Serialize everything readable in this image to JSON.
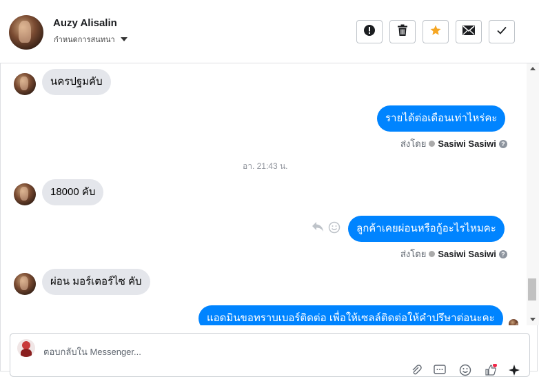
{
  "header": {
    "name": "Auzy Alisalin",
    "subtitle": "กำหนดการสนทนา",
    "buttons": [
      {
        "name": "report-button",
        "icon": "exclamation-icon"
      },
      {
        "name": "delete-button",
        "icon": "trash-icon"
      },
      {
        "name": "star-button",
        "icon": "star-icon"
      },
      {
        "name": "mail-button",
        "icon": "envelope-icon"
      },
      {
        "name": "done-button",
        "icon": "check-icon"
      }
    ]
  },
  "messages": {
    "m1": "นครปฐมคับ",
    "m2": "รายได้ต่อเดือนเท่าไหร่คะ",
    "m3": "18000 คับ",
    "m4": "ลูกค้าเคยผ่อนหรือกู้อะไรไหมคะ",
    "m5": "ผ่อน มอร์เตอร์ไซ คับ",
    "m6": "แอดมินขอทราบเบอร์ติดต่อ เพื่อให้เซลล์ติดต่อให้คำปรึษาต่อนะคะ"
  },
  "sent_by": {
    "label": "ส่งโดย",
    "agent": "Sasiwi Sasiwi",
    "help": "?"
  },
  "timestamp": "อา. 21:43 น.",
  "composer": {
    "placeholder": "ตอบกลับใน Messenger..."
  },
  "colors": {
    "accent": "#0084ff",
    "incoming_bubble": "#e4e6eb",
    "star": "#f5a623"
  }
}
